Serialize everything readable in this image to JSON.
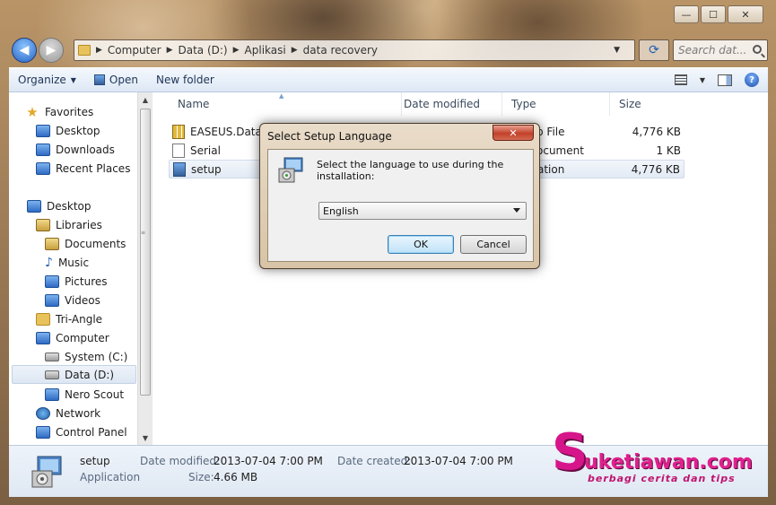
{
  "window": {
    "controls": {
      "minimize": "—",
      "maximize": "☐",
      "close": "✕"
    }
  },
  "address_bar": {
    "crumbs": [
      "Computer",
      "Data (D:)",
      "Aplikasi",
      "data recovery"
    ],
    "search_placeholder": "Search dat..."
  },
  "toolbar": {
    "organize_label": "Organize",
    "open_label": "Open",
    "new_folder_label": "New folder"
  },
  "sidebar": {
    "items": [
      {
        "label": "Favorites",
        "icon": "star-icon"
      },
      {
        "label": "Desktop",
        "icon": "desktop-icon"
      },
      {
        "label": "Downloads",
        "icon": "downloads-icon"
      },
      {
        "label": "Recent Places",
        "icon": "recent-places-icon"
      },
      {
        "label": "Desktop",
        "icon": "desktop-icon"
      },
      {
        "label": "Libraries",
        "icon": "libraries-icon"
      },
      {
        "label": "Documents",
        "icon": "documents-icon"
      },
      {
        "label": "Music",
        "icon": "music-icon"
      },
      {
        "label": "Pictures",
        "icon": "pictures-icon"
      },
      {
        "label": "Videos",
        "icon": "videos-icon"
      },
      {
        "label": "Tri-Angle",
        "icon": "user-folder-icon"
      },
      {
        "label": "Computer",
        "icon": "computer-icon"
      },
      {
        "label": "System (C:)",
        "icon": "drive-icon"
      },
      {
        "label": "Data (D:)",
        "icon": "drive-icon"
      },
      {
        "label": "Nero Scout",
        "icon": "nero-icon"
      },
      {
        "label": "Network",
        "icon": "network-icon"
      },
      {
        "label": "Control Panel",
        "icon": "control-panel-icon"
      }
    ]
  },
  "columns": {
    "name": "Name",
    "date_modified": "Date modified",
    "type": "Type",
    "size": "Size"
  },
  "files": [
    {
      "name": "EASEUS.Data.Re",
      "type": "p File",
      "size": "4,776 KB",
      "icon": "zip-icon"
    },
    {
      "name": "Serial",
      "type": "ocument",
      "size": "1 KB",
      "icon": "document-icon"
    },
    {
      "name": "setup",
      "type": "ation",
      "size": "4,776 KB",
      "icon": "setup-icon"
    }
  ],
  "details": {
    "name": "setup",
    "kind": "Application",
    "date_modified_label": "Date modified:",
    "date_modified": "2013-07-04 7:00 PM",
    "date_created_label": "Date created:",
    "date_created": "2013-07-04 7:00 PM",
    "size_label": "Size:",
    "size": "4.66 MB"
  },
  "dialog": {
    "title": "Select Setup Language",
    "message": "Select the language to use during the installation:",
    "selected_language": "English",
    "ok_label": "OK",
    "cancel_label": "Cancel"
  },
  "watermark": {
    "logo_letter": "S",
    "site": "uketiawan.com",
    "tagline": "berbagi cerita dan tips"
  }
}
